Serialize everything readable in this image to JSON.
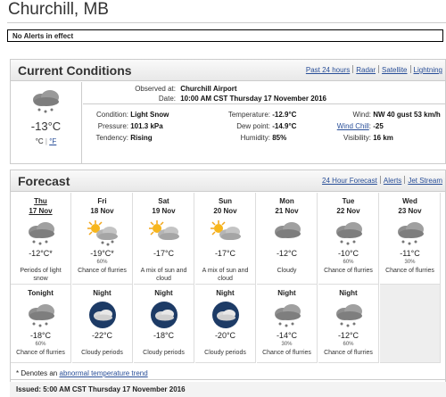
{
  "location": "Churchill, MB",
  "alerts": "No Alerts in effect",
  "current": {
    "title": "Current Conditions",
    "links": [
      "Past 24 hours",
      "Radar",
      "Satellite",
      "Lightning"
    ],
    "temp": "-13°C",
    "unit_c": "°C",
    "unit_f": "°F",
    "observed_label": "Observed at:",
    "observed_value": "Churchill Airport",
    "date_label": "Date:",
    "date_value": "10:00 AM CST Thursday 17 November 2016",
    "condition_label": "Condition:",
    "condition_value": "Light Snow",
    "pressure_label": "Pressure:",
    "pressure_value": "101.3 kPa",
    "tendency_label": "Tendency:",
    "tendency_value": "Rising",
    "temperature_label": "Temperature:",
    "temperature_value": "-12.9°C",
    "dewpoint_label": "Dew point:",
    "dewpoint_value": "-14.9°C",
    "humidity_label": "Humidity:",
    "humidity_value": "85%",
    "wind_label": "Wind:",
    "wind_value": "NW 40 gust 53 km/h",
    "windchill_label": "Wind Chill",
    "windchill_colon": ":",
    "windchill_value": "-25",
    "visibility_label": "Visibility:",
    "visibility_value": "16 km"
  },
  "forecast": {
    "title": "Forecast",
    "links": [
      "24 Hour Forecast",
      "Alerts",
      "Jet Stream"
    ],
    "days": [
      {
        "day": "Thu",
        "date": "17 Nov",
        "icon": "snow-cloud-icon",
        "temp": "-12°C*",
        "pop": "",
        "desc": "Periods of light snow"
      },
      {
        "day": "Fri",
        "date": "18 Nov",
        "icon": "sun-snow-icon",
        "temp": "-19°C*",
        "pop": "60%",
        "desc": "Chance of flurries"
      },
      {
        "day": "Sat",
        "date": "19 Nov",
        "icon": "sun-cloud-icon",
        "temp": "-17°C",
        "pop": "",
        "desc": "A mix of sun and cloud"
      },
      {
        "day": "Sun",
        "date": "20 Nov",
        "icon": "sun-cloud-icon",
        "temp": "-17°C",
        "pop": "",
        "desc": "A mix of sun and cloud"
      },
      {
        "day": "Mon",
        "date": "21 Nov",
        "icon": "cloud-icon",
        "temp": "-12°C",
        "pop": "",
        "desc": "Cloudy"
      },
      {
        "day": "Tue",
        "date": "22 Nov",
        "icon": "snow-cloud-icon",
        "temp": "-10°C",
        "pop": "60%",
        "desc": "Chance of flurries"
      },
      {
        "day": "Wed",
        "date": "23 Nov",
        "icon": "snow-cloud-icon",
        "temp": "-11°C",
        "pop": "30%",
        "desc": "Chance of flurries"
      }
    ],
    "nights": [
      {
        "day": "Tonight",
        "icon": "snow-cloud-icon",
        "temp": "-18°C",
        "pop": "60%",
        "desc": "Chance of flurries"
      },
      {
        "day": "Night",
        "icon": "night-cloud-icon",
        "temp": "-22°C",
        "pop": "",
        "desc": "Cloudy periods"
      },
      {
        "day": "Night",
        "icon": "night-cloud-icon",
        "temp": "-18°C",
        "pop": "",
        "desc": "Cloudy periods"
      },
      {
        "day": "Night",
        "icon": "night-cloud-icon",
        "temp": "-20°C",
        "pop": "",
        "desc": "Cloudy periods"
      },
      {
        "day": "Night",
        "icon": "snow-cloud-icon",
        "temp": "-14°C",
        "pop": "30%",
        "desc": "Chance of flurries"
      },
      {
        "day": "Night",
        "icon": "snow-cloud-icon",
        "temp": "-12°C",
        "pop": "60%",
        "desc": "Chance of flurries"
      }
    ]
  },
  "note_prefix": "* Denotes an",
  "note_link": "abnormal temperature trend",
  "issued": "Issued: 5:00 AM CST Thursday 17 November 2016"
}
